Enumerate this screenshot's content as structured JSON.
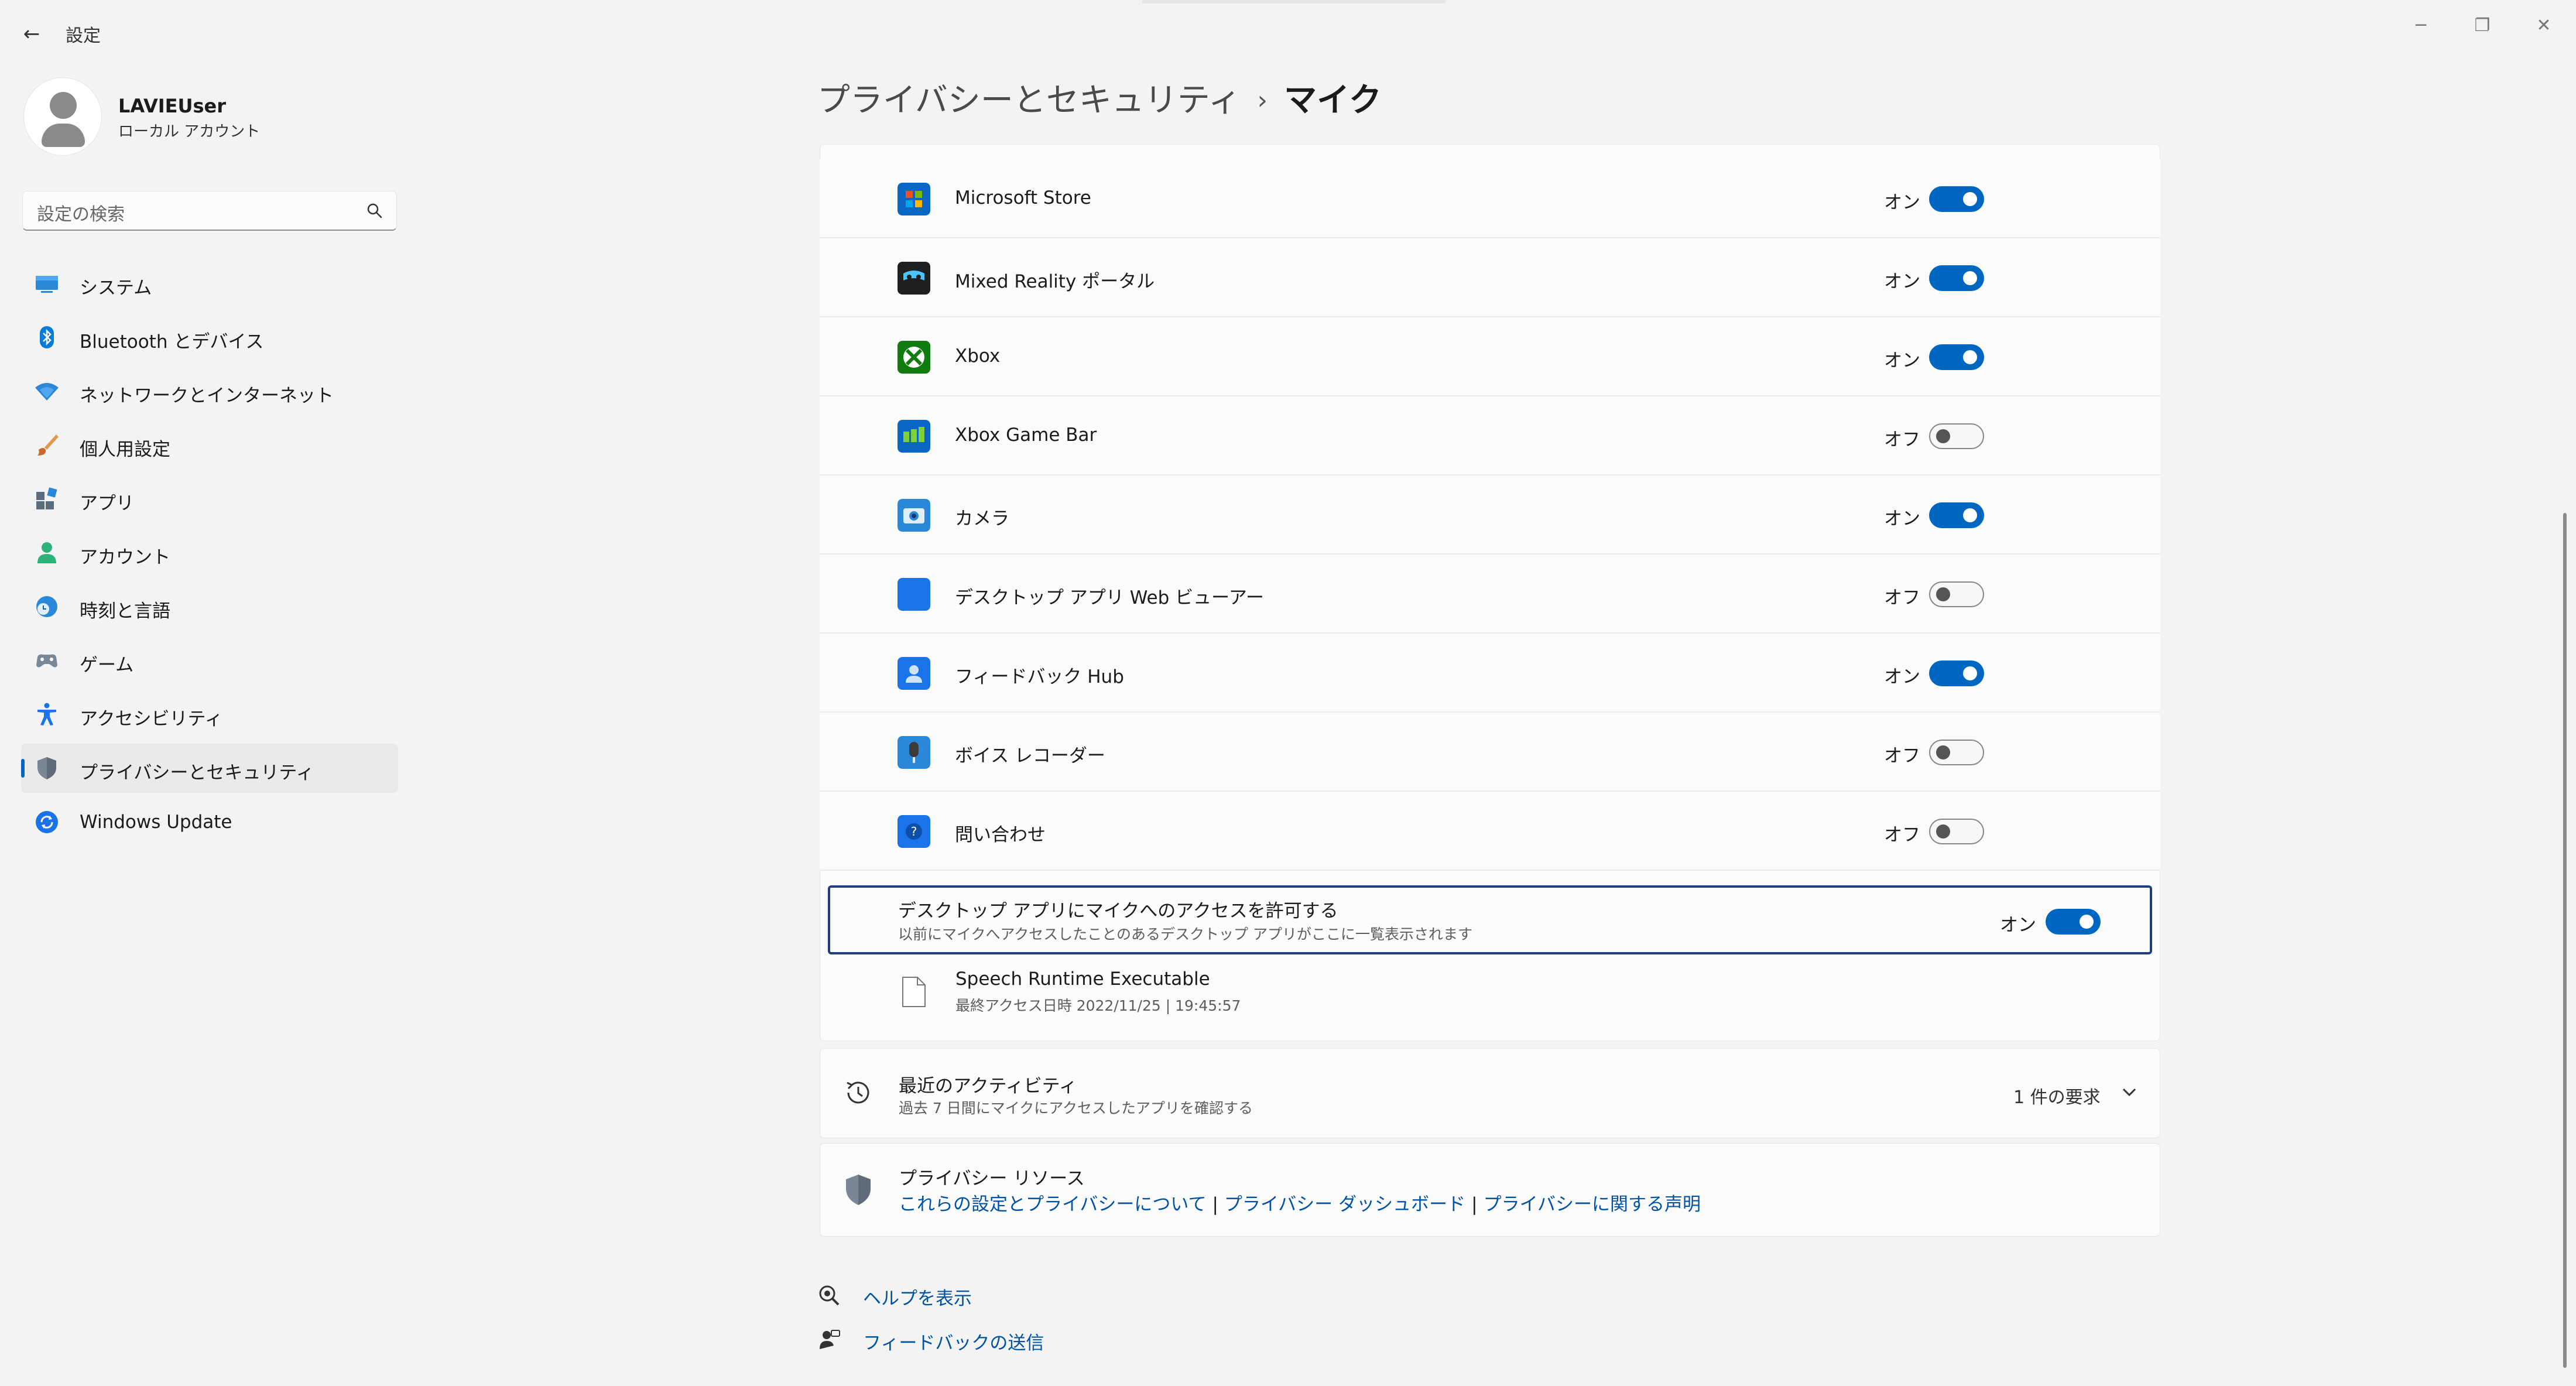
{
  "titlebar": {
    "back": "←",
    "title": "設定",
    "minimize": "─",
    "maximize": "❐",
    "close": "✕"
  },
  "user": {
    "name": "LAVIEUser",
    "account_type": "ローカル アカウント"
  },
  "search": {
    "placeholder": "設定の検索"
  },
  "sidebar": {
    "items": [
      {
        "label": "システム",
        "icon": "monitor-icon",
        "active": false
      },
      {
        "label": "Bluetooth とデバイス",
        "icon": "bluetooth-icon",
        "active": false
      },
      {
        "label": "ネットワークとインターネット",
        "icon": "wifi-icon",
        "active": false
      },
      {
        "label": "個人用設定",
        "icon": "brush-icon",
        "active": false
      },
      {
        "label": "アプリ",
        "icon": "apps-icon",
        "active": false
      },
      {
        "label": "アカウント",
        "icon": "person-icon",
        "active": false
      },
      {
        "label": "時刻と言語",
        "icon": "globe-clock-icon",
        "active": false
      },
      {
        "label": "ゲーム",
        "icon": "gamepad-icon",
        "active": false
      },
      {
        "label": "アクセシビリティ",
        "icon": "accessibility-icon",
        "active": false
      },
      {
        "label": "プライバシーとセキュリティ",
        "icon": "shield-icon",
        "active": true
      },
      {
        "label": "Windows Update",
        "icon": "update-icon",
        "active": false
      }
    ]
  },
  "breadcrumb": {
    "parent": "プライバシーとセキュリティ",
    "separator": "›",
    "current": "マイク"
  },
  "apps": [
    {
      "name": "Microsoft Store",
      "state": "オン",
      "on": true,
      "icon": "store-icon",
      "color": "#0a66c2"
    },
    {
      "name": "Mixed Reality ポータル",
      "state": "オン",
      "on": true,
      "icon": "mixed-reality-icon",
      "color": "#1f1f1f"
    },
    {
      "name": "Xbox",
      "state": "オン",
      "on": true,
      "icon": "xbox-icon",
      "color": "#107c10"
    },
    {
      "name": "Xbox Game Bar",
      "state": "オフ",
      "on": false,
      "icon": "game-bar-icon",
      "color": "#0a66c2"
    },
    {
      "name": "カメラ",
      "state": "オン",
      "on": true,
      "icon": "camera-icon",
      "color": "#2b88d8"
    },
    {
      "name": "デスクトップ アプリ Web ビューアー",
      "state": "オフ",
      "on": false,
      "icon": "web-viewer-icon",
      "color": "#1a73e8"
    },
    {
      "name": "フィードバック Hub",
      "state": "オン",
      "on": true,
      "icon": "feedback-hub-icon",
      "color": "#1a73e8"
    },
    {
      "name": "ボイス レコーダー",
      "state": "オフ",
      "on": false,
      "icon": "voice-recorder-icon",
      "color": "#2b88d8"
    },
    {
      "name": "問い合わせ",
      "state": "オフ",
      "on": false,
      "icon": "get-help-icon",
      "color": "#1a73e8"
    }
  ],
  "desktop_access": {
    "title": "デスクトップ アプリにマイクへのアクセスを許可する",
    "subtitle": "以前にマイクへアクセスしたことのあるデスクトップ アプリがここに一覧表示されます",
    "state": "オン",
    "on": true
  },
  "desktop_apps": [
    {
      "name": "Speech Runtime Executable",
      "last_access": "最終アクセス日時 2022/11/25 | 19:45:57"
    }
  ],
  "recent_activity": {
    "title": "最近のアクティビティ",
    "subtitle": "過去 7 日間にマイクにアクセスしたアプリを確認する",
    "count": "1 件の要求"
  },
  "privacy_resources": {
    "title": "プライバシー リソース",
    "links": [
      "これらの設定とプライバシーについて",
      "プライバシー ダッシュボード",
      "プライバシーに関する声明"
    ],
    "separator": "|"
  },
  "footer": {
    "help": "ヘルプを表示",
    "feedback": "フィードバックの送信"
  },
  "colors": {
    "accent": "#0067c0",
    "link": "#0052a3",
    "background": "#f3f3f3",
    "card": "#fbfbfb"
  }
}
